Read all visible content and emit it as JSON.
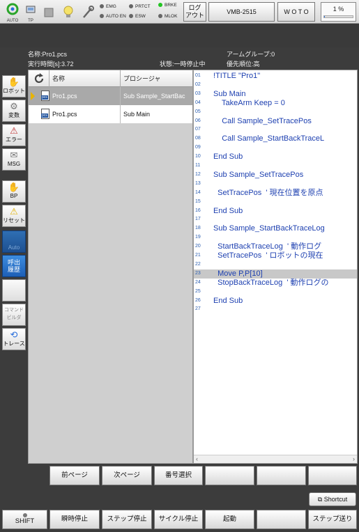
{
  "topbar": {
    "auto_label": "AUTO",
    "tp_label": "TP",
    "status": [
      {
        "label": "EMG",
        "on": false
      },
      {
        "label": "PRTCT",
        "on": false
      },
      {
        "label": "BRKE",
        "on": true
      },
      {
        "label": "AUTO EN",
        "on": false
      },
      {
        "label": "ESW",
        "on": false
      },
      {
        "label": "MLOK",
        "on": false
      }
    ],
    "logout_label": "ログ\nアウト",
    "robot_model": "VMB-2515",
    "woto_label": "W O T O",
    "speed_label": "1 %",
    "speed_percent": 1
  },
  "info": {
    "name": "名称:Pro1.pcs",
    "arm_group": "アームグループ:0",
    "exec_time": "実行時間[s]:3.72",
    "state": "状態:一時停止中",
    "priority": "優先順位:高"
  },
  "left_toolbar": [
    {
      "label": "ロボット",
      "icon": "robot-icon",
      "glyph": "✋"
    },
    {
      "label": "変数",
      "icon": "variable-icon",
      "glyph": "⚙"
    },
    {
      "label": "エラー",
      "icon": "error-icon",
      "glyph": "⚠"
    },
    {
      "label": "MSG",
      "icon": "message-icon",
      "glyph": "✉"
    },
    {
      "label": "BP",
      "icon": "breakpoint-icon",
      "glyph": "✋"
    },
    {
      "label": "リセット",
      "icon": "reset-icon",
      "glyph": "⚠"
    },
    {
      "label": "Auto",
      "icon": "",
      "glyph": ""
    },
    {
      "label": "呼出\n履歴",
      "icon": "",
      "glyph": ""
    },
    {
      "label": "",
      "icon": "",
      "glyph": ""
    },
    {
      "label": "コマンド\nビルダ",
      "icon": "",
      "glyph": ""
    },
    {
      "label": "トレース",
      "icon": "trace-icon",
      "glyph": "⟲"
    }
  ],
  "filelist": {
    "col_name": "名称",
    "col_proc": "プロシージャ",
    "rows": [
      {
        "name": "Pro1.pcs",
        "proc": "Sub Sample_StartBac",
        "selected": true
      },
      {
        "name": "Pro1.pcs",
        "proc": "Sub Main",
        "selected": false
      }
    ]
  },
  "code": [
    {
      "ln": "01",
      "text": "!TITLE \"Pro1\"",
      "hl": false
    },
    {
      "ln": "02",
      "text": "",
      "hl": false
    },
    {
      "ln": "03",
      "text": "Sub Main",
      "hl": false
    },
    {
      "ln": "04",
      "text": "    TakeArm Keep = 0",
      "hl": false
    },
    {
      "ln": "05",
      "text": "",
      "hl": false
    },
    {
      "ln": "06",
      "text": "    Call Sample_SetTracePos",
      "hl": false
    },
    {
      "ln": "07",
      "text": "",
      "hl": false
    },
    {
      "ln": "08",
      "text": "    Call Sample_StartBackTraceL",
      "hl": false
    },
    {
      "ln": "09",
      "text": "",
      "hl": false
    },
    {
      "ln": "10",
      "text": "End Sub",
      "hl": false
    },
    {
      "ln": "11",
      "text": "",
      "hl": false
    },
    {
      "ln": "12",
      "text": "Sub Sample_SetTracePos",
      "hl": false
    },
    {
      "ln": "13",
      "text": "",
      "hl": false
    },
    {
      "ln": "14",
      "text": "  SetTracePos  ' 現在位置を原点",
      "hl": false
    },
    {
      "ln": "15",
      "text": "",
      "hl": false
    },
    {
      "ln": "16",
      "text": "End Sub",
      "hl": false
    },
    {
      "ln": "17",
      "text": "",
      "hl": false
    },
    {
      "ln": "18",
      "text": "Sub Sample_StartBackTraceLog",
      "hl": false
    },
    {
      "ln": "19",
      "text": "",
      "hl": false
    },
    {
      "ln": "20",
      "text": "  StartBackTraceLog  ' 動作ログ",
      "hl": false
    },
    {
      "ln": "21",
      "text": "  SetTracePos  ' ロボットの現在",
      "hl": false
    },
    {
      "ln": "22",
      "text": "",
      "hl": false
    },
    {
      "ln": "23",
      "text": "  Move P,P[10]",
      "hl": true
    },
    {
      "ln": "24",
      "text": "  StopBackTraceLog  ' 動作ログの",
      "hl": false
    },
    {
      "ln": "25",
      "text": "",
      "hl": false
    },
    {
      "ln": "26",
      "text": "End Sub",
      "hl": false
    },
    {
      "ln": "27",
      "text": "",
      "hl": false
    }
  ],
  "page_buttons": [
    "前ページ",
    "次ページ",
    "番号選択",
    "",
    "",
    ""
  ],
  "shortcut_label": "Shortcut",
  "bottom_buttons": [
    "SHIFT",
    "瞬時停止",
    "ステップ停止",
    "サイクル停止",
    "起動",
    "",
    "ステップ送り"
  ]
}
